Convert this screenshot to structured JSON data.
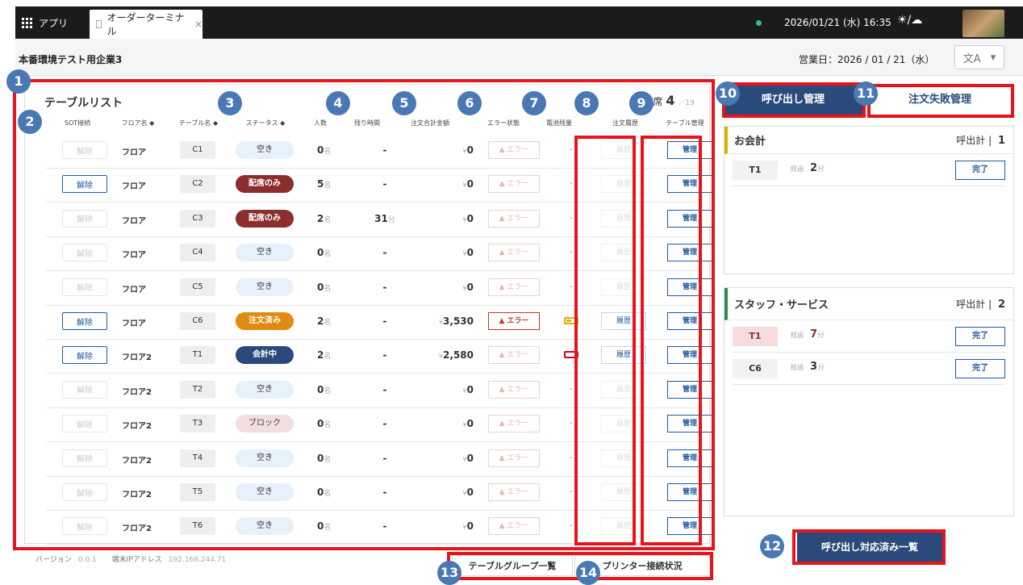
{
  "topbar": {
    "apps_label": "アプリ",
    "tab_label": "オーダーターミナル",
    "tab_close": "×",
    "datetime": "2026/01/21 (水) 16:35",
    "weather": "☀/☁"
  },
  "company": {
    "name": "本番環境テスト用企業3",
    "business_date": "営業日：2026 / 01 / 21（水）",
    "lang_icon": "文A",
    "lang_arrow": "▾"
  },
  "table_list": {
    "title": "テーブルリスト",
    "seats_label": "配席",
    "seats_count": "4",
    "seats_total": "／19",
    "columns": [
      "SOT接続",
      "フロア名 ◆",
      "テーブル名 ◆",
      "ステータス ◆",
      "人数",
      "残り時間",
      "注文合計金額",
      "エラー状態",
      "電池残量",
      "注文履歴",
      "テーブル管理"
    ],
    "rows": [
      {
        "sot": "解除",
        "floor": "フロア",
        "table": "C1",
        "status": "空き",
        "people": "0",
        "remain": "-",
        "amount": "0",
        "error": "▲ エラー",
        "battery": "-",
        "history": "履歴",
        "manage": "管理"
      },
      {
        "sot": "解除",
        "floor": "フロア",
        "table": "C2",
        "status": "配席のみ",
        "people": "5",
        "remain": "-",
        "amount": "0",
        "error": "▲ エラー",
        "battery": "-",
        "history": "履歴",
        "manage": "管理"
      },
      {
        "sot": "解除",
        "floor": "フロア",
        "table": "C3",
        "status": "配席のみ",
        "people": "2",
        "remain": "31",
        "amount": "0",
        "error": "▲ エラー",
        "battery": "-",
        "history": "履歴",
        "manage": "管理"
      },
      {
        "sot": "解除",
        "floor": "フロア",
        "table": "C4",
        "status": "空き",
        "people": "0",
        "remain": "-",
        "amount": "0",
        "error": "▲ エラー",
        "battery": "-",
        "history": "履歴",
        "manage": "管理"
      },
      {
        "sot": "解除",
        "floor": "フロア",
        "table": "C5",
        "status": "空き",
        "people": "0",
        "remain": "-",
        "amount": "0",
        "error": "▲ エラー",
        "battery": "-",
        "history": "履歴",
        "manage": "管理"
      },
      {
        "sot": "解除",
        "floor": "フロア",
        "table": "C6",
        "status": "注文済み",
        "people": "2",
        "remain": "-",
        "amount": "3,530",
        "error": "▲ エラー",
        "battery": "",
        "history": "履歴",
        "manage": "管理"
      },
      {
        "sot": "解除",
        "floor": "フロア2",
        "table": "T1",
        "status": "会計中",
        "people": "2",
        "remain": "-",
        "amount": "2,580",
        "error": "▲ エラー",
        "battery": "",
        "history": "履歴",
        "manage": "管理"
      },
      {
        "sot": "解除",
        "floor": "フロア2",
        "table": "T2",
        "status": "空き",
        "people": "0",
        "remain": "-",
        "amount": "0",
        "error": "▲ エラー",
        "battery": "-",
        "history": "履歴",
        "manage": "管理"
      },
      {
        "sot": "解除",
        "floor": "フロア2",
        "table": "T3",
        "status": "ブロック",
        "people": "0",
        "remain": "-",
        "amount": "0",
        "error": "▲ エラー",
        "battery": "-",
        "history": "履歴",
        "manage": "管理"
      },
      {
        "sot": "解除",
        "floor": "フロア2",
        "table": "T4",
        "status": "空き",
        "people": "0",
        "remain": "-",
        "amount": "0",
        "error": "▲ エラー",
        "battery": "-",
        "history": "履歴",
        "manage": "管理"
      },
      {
        "sot": "解除",
        "floor": "フロア2",
        "table": "T5",
        "status": "空き",
        "people": "0",
        "remain": "-",
        "amount": "0",
        "error": "▲ エラー",
        "battery": "-",
        "history": "履歴",
        "manage": "管理"
      },
      {
        "sot": "解除",
        "floor": "フロア2",
        "table": "T6",
        "status": "空き",
        "people": "0",
        "remain": "-",
        "amount": "0",
        "error": "▲ エラー",
        "battery": "-",
        "history": "履歴",
        "manage": "管理"
      }
    ],
    "unit_people": "名",
    "unit_minutes": "分",
    "currency": "¥"
  },
  "footer": {
    "version_label": "バージョン",
    "version": "0.0.1",
    "ip_label": "端末IPアドレス",
    "ip": "192.168.244.71",
    "group_tab": "テーブルグループ一覧",
    "printer_tab": "プリンター接続状況"
  },
  "calls": {
    "tab_call": "呼び出し管理",
    "tab_fail": "注文失敗管理",
    "total_label": "呼出計",
    "elapsed_label": "経過",
    "done_label": "完了",
    "checkout": {
      "title": "お会計",
      "count": "1",
      "items": [
        {
          "table": "T1",
          "minutes": "2"
        }
      ]
    },
    "staff": {
      "title": "スタッフ・サービス",
      "count": "2",
      "items": [
        {
          "table": "T1",
          "minutes": "7"
        },
        {
          "table": "C6",
          "minutes": "3"
        }
      ]
    },
    "resolved_button": "呼び出し対応済み一覧"
  },
  "badges": [
    "1",
    "2",
    "3",
    "4",
    "5",
    "6",
    "7",
    "8",
    "9",
    "10",
    "11",
    "12",
    "13",
    "14"
  ],
  "colors": {
    "accent": "#2b4a7c",
    "annotation": "#e8141b",
    "badge": "#4a78b4"
  }
}
